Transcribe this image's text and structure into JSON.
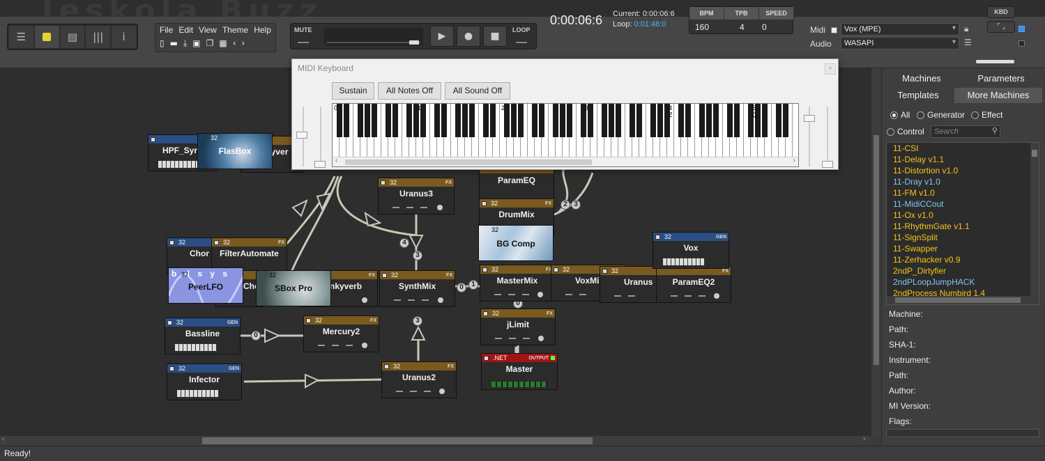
{
  "app": {
    "title": "Jeskola Buzz"
  },
  "colors": {
    "accent_yellow": "#e8d233",
    "cyan_text": "#47b5ff",
    "machine_yellow": "#f5c518",
    "machine_blue": "#7ec8f0",
    "fx_header": "#7a5a1e",
    "gen_header": "#2b4e84",
    "output_header": "#a11414"
  },
  "view_buttons": [
    {
      "icon": "machine-view-icon"
    },
    {
      "icon": "pattern-view-icon"
    },
    {
      "icon": "sequence-view-icon"
    },
    {
      "icon": "wavetable-view-icon"
    },
    {
      "icon": "info-view-icon"
    }
  ],
  "menu": {
    "items": [
      "File",
      "Edit",
      "View",
      "Theme",
      "Help"
    ],
    "file_buttons": [
      "new-file-icon",
      "open-folder-icon",
      "save-icon",
      "save-as-icon",
      "copy-icon",
      "paste-icon",
      "undo-icon",
      "redo-icon"
    ]
  },
  "transport": {
    "mute": "MUTE",
    "loop": "LOOP",
    "position": 0.88
  },
  "clock": "0:00:06:6",
  "position_info": {
    "current_label": "Current:",
    "current": "0:00:06:6",
    "loop_label": "Loop:",
    "loop": "0:01:48:0"
  },
  "tempo": {
    "bpm_label": "BPM",
    "bpm": "160",
    "tpb_label": "TPB",
    "tpb": "4",
    "speed_label": "SPEED",
    "speed": "0"
  },
  "io": {
    "midi_label": "Midi",
    "midi_device": "Vox (MPE)",
    "audio_label": "Audio",
    "audio_device": "WASAPI"
  },
  "kbd_label": "KBD",
  "midi_keyboard": {
    "title": "MIDI Keyboard",
    "close": "×",
    "sustain": "Sustain",
    "all_notes_off": "All Notes Off",
    "all_sound_off": "All Sound Off",
    "octave_labels": [
      "0",
      "1",
      "2",
      "3",
      "4",
      "5"
    ],
    "key_hints": {
      "z": "Z",
      "q": "Q"
    }
  },
  "machines": {
    "hpf": {
      "name": "HPF_Syr"
    },
    "flasbox": {
      "name": "FlasBox",
      "tag": "32"
    },
    "chorus": {
      "name": "Chor",
      "tag": "32"
    },
    "filterautomate": {
      "name": "FilterAutomate",
      "tag": "32",
      "type": "FX"
    },
    "peerlfo": {
      "name": "PeerLFO",
      "tag": "32",
      "logo": "b d s y s"
    },
    "sboxpro": {
      "name": "SBox Pro",
      "tag": "32"
    },
    "chorus2": {
      "name": "Cho"
    },
    "funkyverb": {
      "name": "nkyverb",
      "type": "FX"
    },
    "uranus3": {
      "name": "Uranus3",
      "tag": "32",
      "type": "FX"
    },
    "parameq": {
      "name": "ParamEQ"
    },
    "drummix": {
      "name": "DrumMix",
      "tag": "32",
      "type": "FX"
    },
    "bgcomp": {
      "name": "BG Comp",
      "tag": "32"
    },
    "synthmix": {
      "name": "SynthMix",
      "tag": "32",
      "type": "FX"
    },
    "mastermix": {
      "name": "MasterMix",
      "tag": "32",
      "type": "FX"
    },
    "voxmix": {
      "name": "VoxMix",
      "tag": "32"
    },
    "uranus": {
      "name": "Uranus",
      "tag": "32"
    },
    "parameq2": {
      "name": "ParamEQ2",
      "type": "FX"
    },
    "vox": {
      "name": "Vox",
      "tag": "32",
      "type": "GEN"
    },
    "bassline": {
      "name": "Bassline",
      "tag": "32",
      "type": "GEN"
    },
    "mercury2": {
      "name": "Mercury2",
      "tag": "32",
      "type": "FX"
    },
    "infector": {
      "name": "Infector",
      "tag": "32",
      "type": "GEN"
    },
    "uranus2": {
      "name": "Uranus2",
      "tag": "32",
      "type": "FX"
    },
    "jlimit": {
      "name": "jLimit",
      "tag": "32",
      "type": "FX"
    },
    "master": {
      "name": "Master",
      "tag": ".NET",
      "type": "OUTPUT"
    }
  },
  "connections": {
    "b1": "4",
    "b2": "3",
    "b3": "2",
    "b4": "3",
    "b5": "0",
    "b6": "1",
    "b7": "0",
    "b8": "0",
    "b9": "3"
  },
  "right_panel": {
    "tabs": [
      "Machines",
      "Parameters",
      "Templates",
      "More Machines"
    ],
    "filters": [
      "All",
      "Generator",
      "Effect",
      "Control"
    ],
    "search_placeholder": "Search",
    "list": [
      {
        "name": "11-CSI",
        "color": "yellow"
      },
      {
        "name": "11-Delay v1.1",
        "color": "yellow"
      },
      {
        "name": "11-Distortion v1.0",
        "color": "yellow"
      },
      {
        "name": "11-Dray v1.0",
        "color": "blue"
      },
      {
        "name": "11-FM v1.0",
        "color": "yellow"
      },
      {
        "name": "11-MidiCCout",
        "color": "blue"
      },
      {
        "name": "11-Ox v1.0",
        "color": "yellow"
      },
      {
        "name": "11-RhythmGate v1.1",
        "color": "yellow"
      },
      {
        "name": "11-SignSplit",
        "color": "yellow"
      },
      {
        "name": "11-Swapper",
        "color": "yellow"
      },
      {
        "name": "11-Zerhacker v0.9",
        "color": "yellow"
      },
      {
        "name": "2ndP_Dirtyfier",
        "color": "yellow"
      },
      {
        "name": "2ndPLoopJumpHACK",
        "color": "blue"
      },
      {
        "name": "2ndProcess Numbird 1.4",
        "color": "yellow"
      }
    ],
    "info_labels": [
      "Machine:",
      "Path:",
      "SHA-1:",
      "Instrument:",
      "Path:",
      "Author:",
      "MI Version:",
      "Flags:"
    ]
  },
  "status": "Ready!"
}
